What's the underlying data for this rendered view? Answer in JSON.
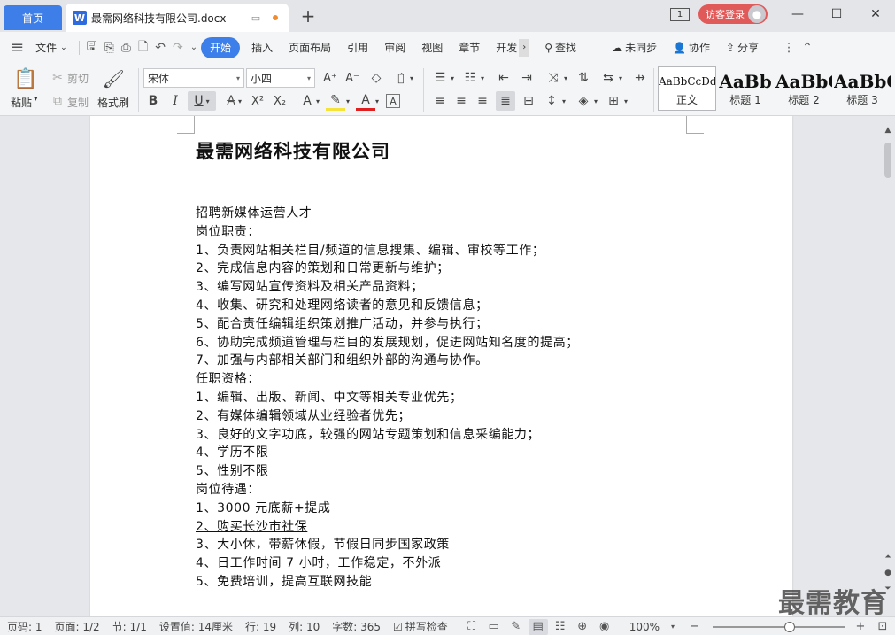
{
  "tabs": {
    "home": "首页",
    "doc_title": "最需网络科技有限公司.docx",
    "new_tab": "+"
  },
  "window": {
    "page_counter": "1",
    "login": "访客登录",
    "minimize": "—",
    "maximize": "☐",
    "close": "✕",
    "restore": "⧉"
  },
  "menu": {
    "hamburger": "≡",
    "file": "文件",
    "items": [
      "开始",
      "插入",
      "页面布局",
      "引用",
      "审阅",
      "视图",
      "章节",
      "开发"
    ],
    "search": "查找",
    "sync": "未同步",
    "collab": "协作",
    "share": "分享"
  },
  "ribbon": {
    "paste": "粘贴",
    "cut": "剪切",
    "copy": "复制",
    "format_painter": "格式刷",
    "font_name": "宋体",
    "font_size": "小四",
    "styles": [
      {
        "preview": "AaBbCcDd",
        "name": "正文"
      },
      {
        "preview": "AaBb",
        "name": "标题 1"
      },
      {
        "preview": "AaBbC",
        "name": "标题 2"
      },
      {
        "preview": "AaBbC",
        "name": "标题 3"
      }
    ]
  },
  "document": {
    "title": "最需网络科技有限公司",
    "lines": [
      "招聘新媒体运营人才",
      "岗位职责：",
      "1、负责网站相关栏目/频道的信息搜集、编辑、审校等工作；",
      "2、完成信息内容的策划和日常更新与维护；",
      "3、编写网站宣传资料及相关产品资料；",
      "4、收集、研究和处理网络读者的意见和反馈信息；",
      "5、配合责任编辑组织策划推广活动，并参与执行；",
      "6、协助完成频道管理与栏目的发展规划，促进网站知名度的提高；",
      "7、加强与内部相关部门和组织外部的沟通与协作。",
      "任职资格：",
      "1、编辑、出版、新闻、中文等相关专业优先；",
      "2、有媒体编辑领域从业经验者优先；",
      "3、良好的文字功底，较强的网站专题策划和信息采编能力；",
      "4、学历不限",
      "5、性别不限",
      "岗位待遇：",
      "1、3000 元底薪+提成",
      "2、购买长沙市社保",
      "3、大小休，带薪休假，节假日同步国家政策",
      "4、日工作时间 7 小时，工作稳定，不外派",
      "5、免费培训，提高互联网技能"
    ]
  },
  "watermark": "最需教育",
  "status": {
    "page_num": "页码: 1",
    "pages": "页面: 1/2",
    "section": "节: 1/1",
    "setting": "设置值: 14厘米",
    "row": "行: 19",
    "col": "列: 10",
    "words": "字数: 365",
    "spell": "拼写检查",
    "zoom": "100%",
    "zoom_level": 0.58
  },
  "colors": {
    "accent": "#3d7fea",
    "login": "#e05a5a",
    "doc_icon": "#2d6bdf",
    "unsaved_dot": "#f08c2e"
  }
}
